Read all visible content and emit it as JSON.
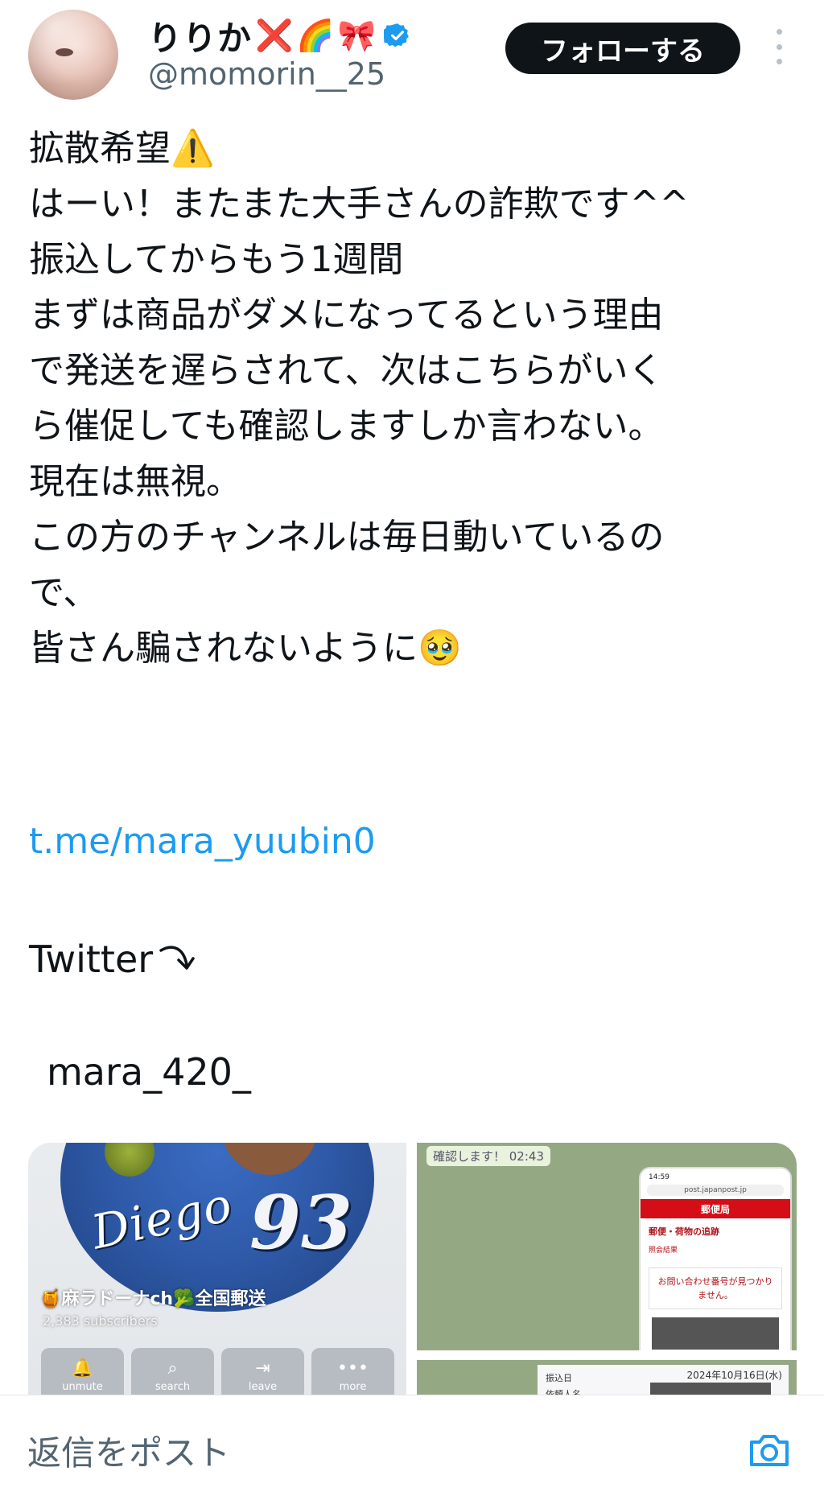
{
  "author": {
    "display_name": "りりか",
    "name_emojis": [
      "❌",
      "🌈",
      "🎀"
    ],
    "handle": "@momorin__25",
    "verified": true,
    "avatar_icon": "avatar-photo"
  },
  "actions": {
    "follow_label": "フォローする",
    "more_icon": "vertical-dots-icon"
  },
  "post": {
    "lines": [
      "拡散希望⚠️",
      "はーい！またまた大手さんの詐欺です^^",
      "振込してからもう1週間",
      "まずは商品がダメになってるという理由",
      "で発送を遅らされて、次はこちらがいく",
      "ら催促しても確認しますしか言わない。",
      "現在は無視。",
      "この方のチャンネルは毎日動いているの",
      "で、",
      "皆さん騙されないように🥹"
    ],
    "link": "t.me/mara_yuubin0",
    "twitter_label": "Twitter",
    "twitter_arrow_icon": "curved-arrow-down-icon",
    "account_text": "mara_420_"
  },
  "media": {
    "left": {
      "diego_text": "Diego",
      "number_text": "93",
      "channel_title": "🍯麻ラドーナch🥦全国郵送",
      "subscribers": "2,383 subscribers",
      "buttons": [
        {
          "icon": "🔔",
          "label": "unmute"
        },
        {
          "icon": "⌕",
          "label": "search"
        },
        {
          "icon": "⇥",
          "label": "leave"
        },
        {
          "icon": "•••",
          "label": "more"
        }
      ]
    },
    "right_top": {
      "chat_time_text": "確認します！ 02:43",
      "phone_time": "14:59",
      "phone_url": "post.japanpost.jp",
      "phone_header": "郵便局",
      "phone_section": "郵便・荷物の追跡",
      "phone_sub": "照会結果",
      "phone_notice": "お問い合わせ番号が見つかりません。"
    },
    "right_bottom": {
      "row1": "振込日",
      "row2": "依頼人名",
      "date": "2024年10月16日(水)"
    }
  },
  "reply": {
    "placeholder": "返信をポスト",
    "camera_icon": "camera-icon"
  },
  "colors": {
    "link": "#1d9bf0",
    "follow_bg": "#0f1419",
    "muted": "#536471",
    "verified": "#1d9bf0"
  }
}
